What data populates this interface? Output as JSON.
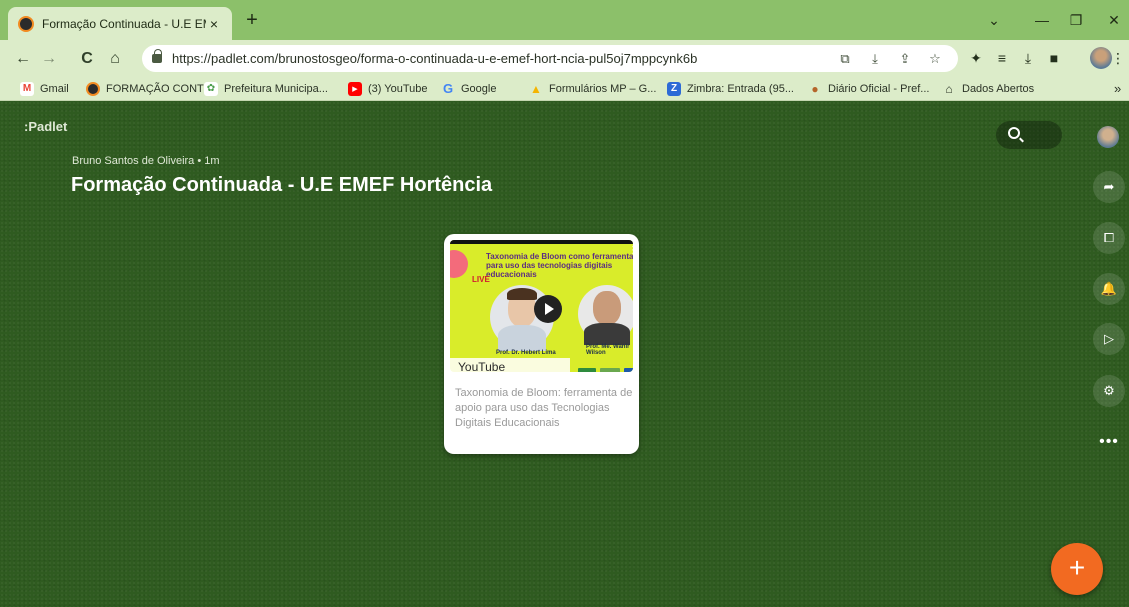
{
  "browser": {
    "tab_title": "Formação Continuada - U.E EMEF",
    "tab_close": "×",
    "new_tab": "+",
    "window_controls": {
      "chevron": "⌄",
      "minimize": "—",
      "restore": "❐",
      "close": "✕"
    },
    "nav": {
      "back": "←",
      "forward": "→",
      "reload": "C",
      "home": "⌂"
    },
    "url": "https://padlet.com/brunostosgeo/forma-o-continuada-u-e-emef-hort-ncia-pul5oj7mppcynk6b",
    "omnibox_icons": {
      "copy": "⧉",
      "install": "⤓",
      "share": "⇪",
      "star": "☆"
    },
    "toolbar_icons": {
      "extensions": "✦",
      "reading_list": "≡",
      "download": "⤓",
      "sidepanel": "■",
      "menu": "⋮"
    },
    "bookmarks": [
      {
        "label": "Gmail",
        "icon": "M",
        "color": "#ea4335"
      },
      {
        "label": "FORMAÇÃO CONTI...",
        "icon": "",
        "color": "#2b2b2b"
      },
      {
        "label": "Prefeitura Municipa...",
        "icon": "✿",
        "color": "#4a9d4a"
      },
      {
        "label": "(3) YouTube",
        "icon": "▶",
        "color": "#ff0000"
      },
      {
        "label": "Google",
        "icon": "G",
        "color": "#4285f4"
      },
      {
        "label": "Formulários MP – G...",
        "icon": "▲",
        "color": "#f4b400"
      },
      {
        "label": "Zimbra: Entrada (95...",
        "icon": "Z",
        "color": "#2d6bd6"
      },
      {
        "label": "Diário Oficial - Pref...",
        "icon": "●",
        "color": "#b5652a"
      },
      {
        "label": "Dados Abertos",
        "icon": "⌂",
        "color": "#2b3326"
      }
    ],
    "bookmarks_more": "»"
  },
  "padlet": {
    "logo": ":Padlet",
    "author": "Bruno Santos de Oliveira • 1m",
    "title": "Formação Continuada - U.E EMEF Hortência",
    "sidebar_icons": [
      "➦",
      "⧠",
      "🔔",
      "▷",
      "⚙"
    ],
    "more": "•••",
    "fab": "+"
  },
  "post": {
    "source_label": "YouTube",
    "description": "Taxonomia de Bloom: ferramenta de apoio para uso das Tecnologias Digitais Educacionais",
    "thumbnail": {
      "title": "Taxonomia de Bloom como ferramenta para uso das tecnologias digitais educacionais",
      "live": "LIVE",
      "name_left": "Prof. Dr. Hebert Lima",
      "name_right": "Prof. Me. Wanir Wilson",
      "kebab": "⋮"
    }
  }
}
